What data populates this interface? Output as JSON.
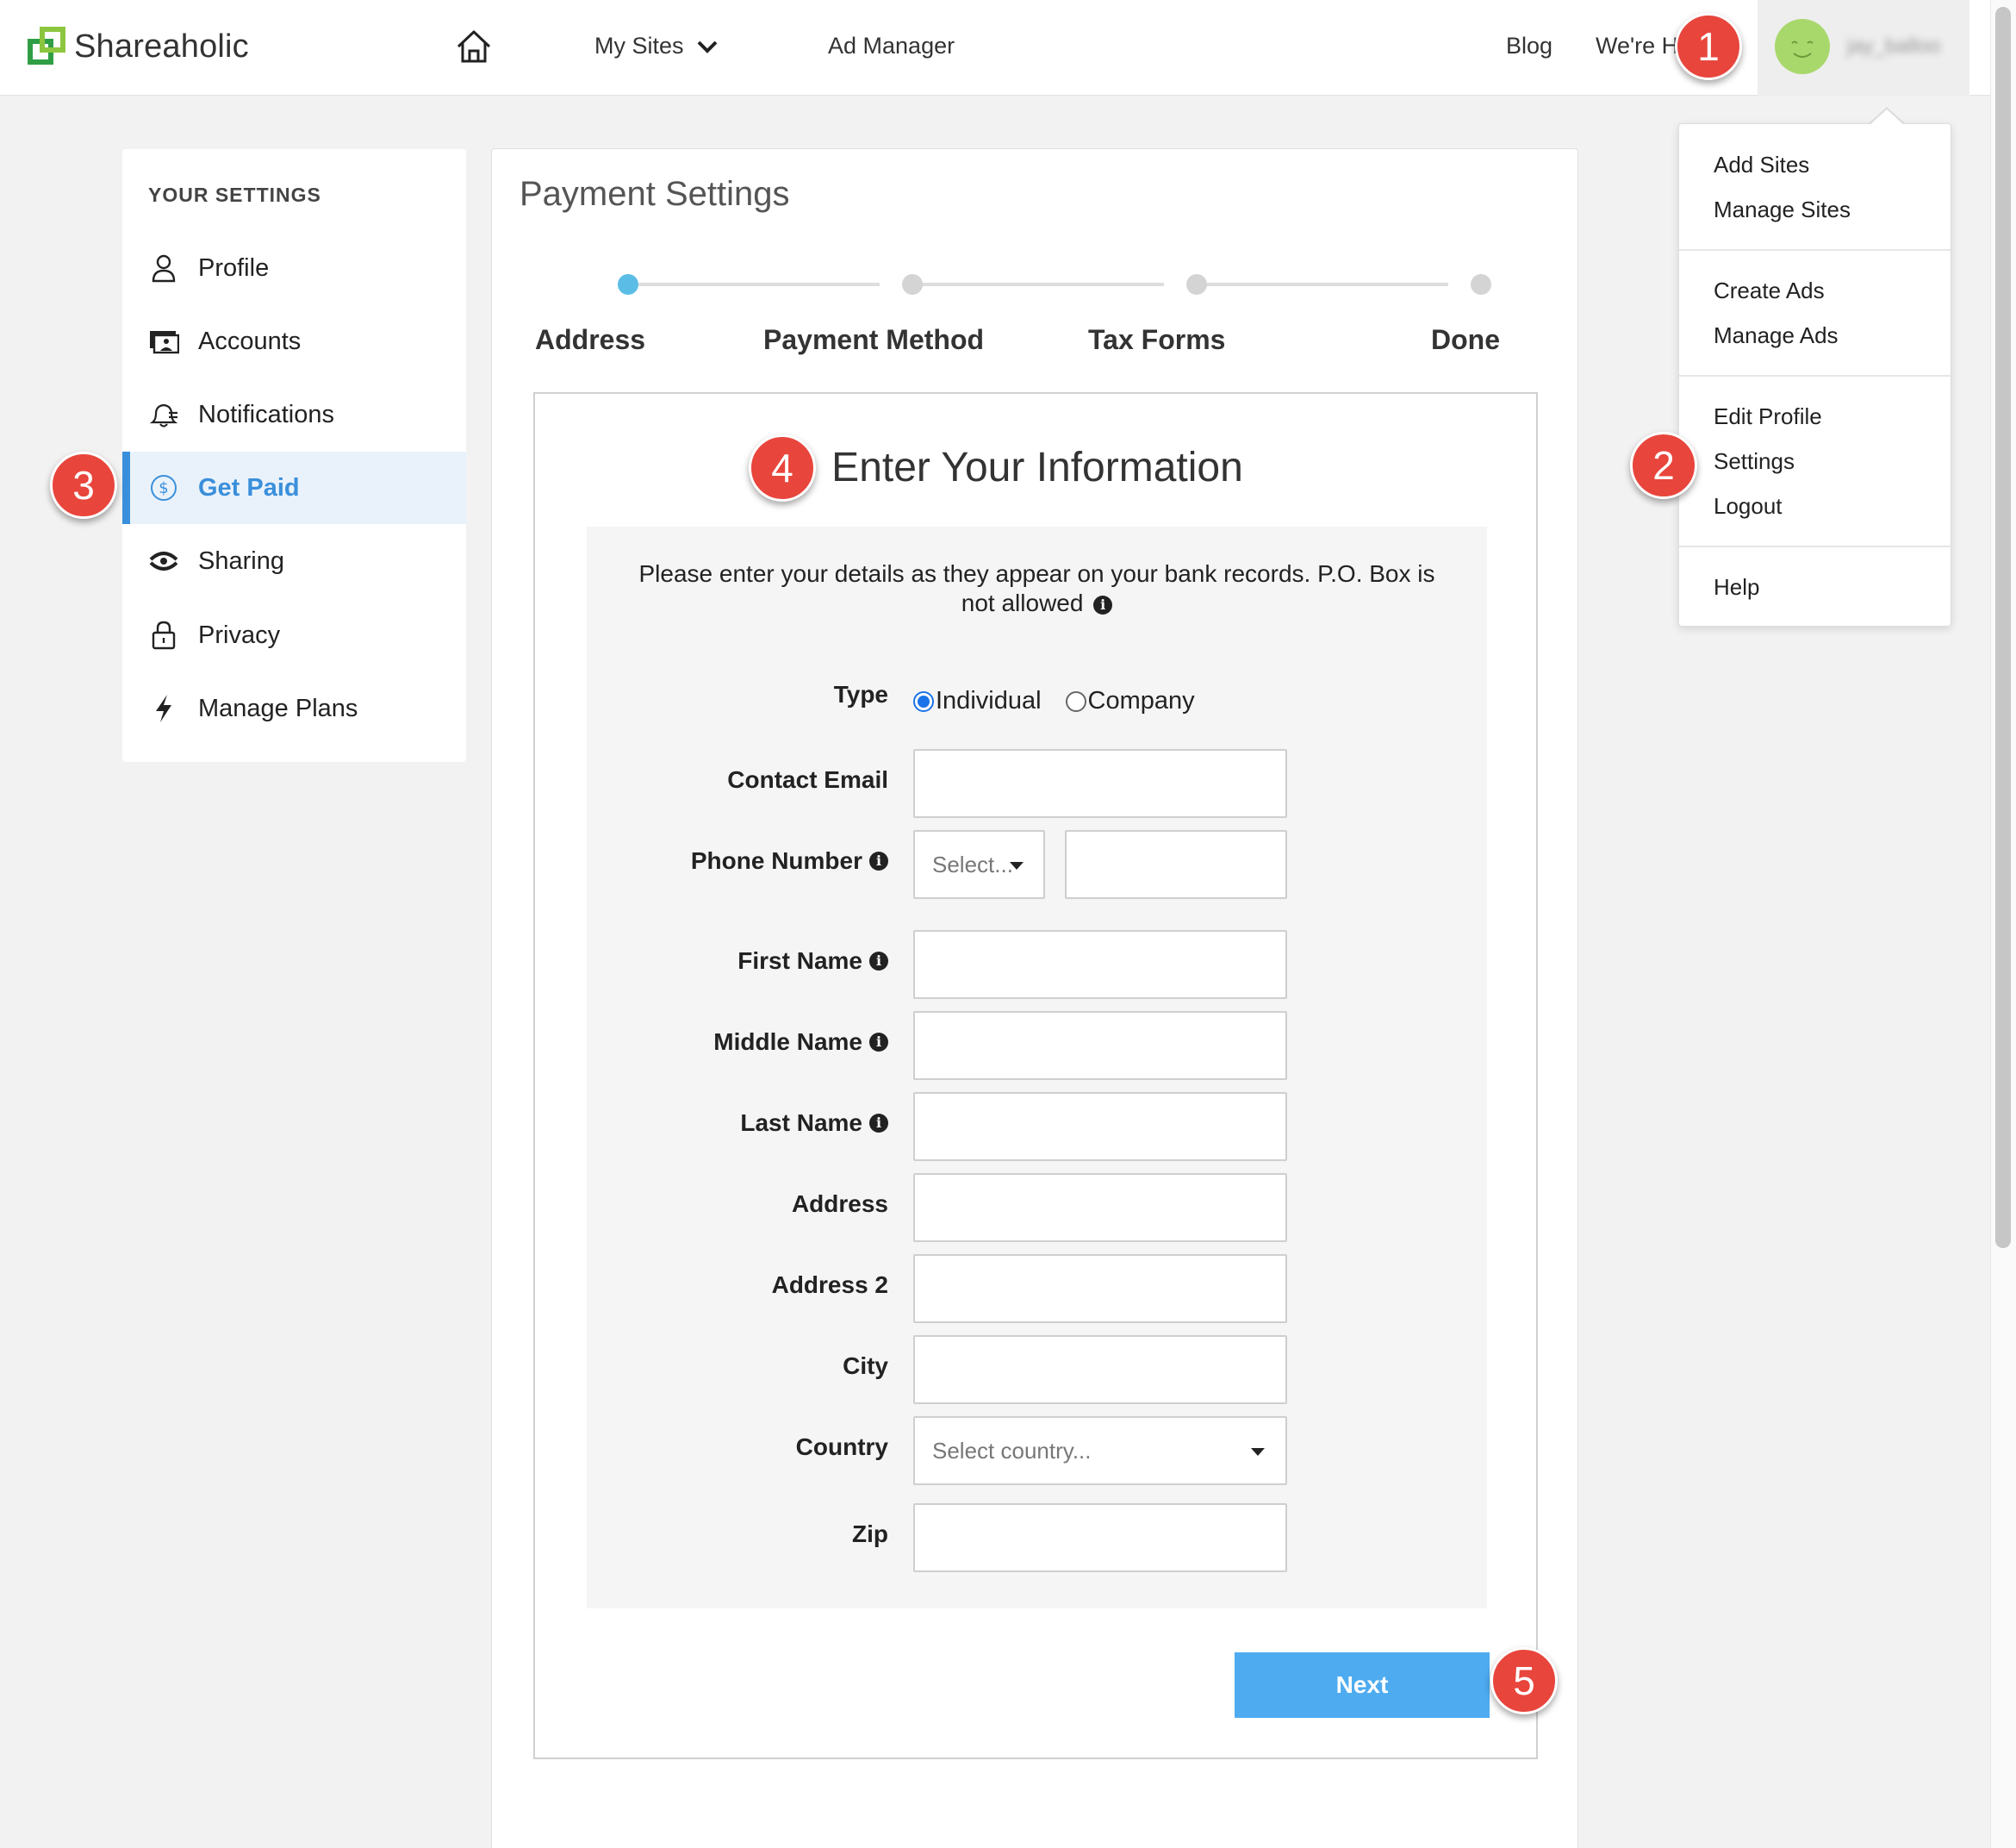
{
  "header": {
    "logo_text": "Shareaholic",
    "nav": {
      "my_sites": "My Sites",
      "ad_manager": "Ad Manager",
      "blog": "Blog",
      "help": "We're Here to Help"
    },
    "user": {
      "name": "jay_balloo"
    }
  },
  "dropdown": {
    "groups": [
      [
        "Add Sites",
        "Manage Sites"
      ],
      [
        "Create Ads",
        "Manage Ads"
      ],
      [
        "Edit Profile",
        "Settings",
        "Logout"
      ],
      [
        "Help"
      ]
    ],
    "add_sites": "Add Sites",
    "manage_sites": "Manage Sites",
    "create_ads": "Create Ads",
    "manage_ads": "Manage Ads",
    "edit_profile": "Edit Profile",
    "settings": "Settings",
    "logout": "Logout",
    "help": "Help"
  },
  "sidebar": {
    "title": "YOUR SETTINGS",
    "items": [
      {
        "label": "Profile",
        "icon": "user-icon"
      },
      {
        "label": "Accounts",
        "icon": "accounts-icon"
      },
      {
        "label": "Notifications",
        "icon": "bell-icon"
      },
      {
        "label": "Get Paid",
        "icon": "dollar-icon",
        "active": true
      },
      {
        "label": "Sharing",
        "icon": "sharing-icon"
      },
      {
        "label": "Privacy",
        "icon": "lock-icon"
      },
      {
        "label": "Manage Plans",
        "icon": "bolt-icon"
      }
    ]
  },
  "main": {
    "title": "Payment Settings",
    "steps": [
      "Address",
      "Payment Method",
      "Tax Forms",
      "Done"
    ],
    "active_step": 0,
    "form": {
      "title": "Enter Your Information",
      "notice": "Please enter your details as they appear on your bank records. P.O. Box is not allowed",
      "type_label": "Type",
      "type_options": [
        "Individual",
        "Company"
      ],
      "type_selected": "Individual",
      "contact_email": "Contact Email",
      "phone_number": "Phone Number",
      "phone_country_placeholder": "Select...",
      "first_name": "First Name",
      "middle_name": "Middle Name",
      "last_name": "Last Name",
      "address": "Address",
      "address2": "Address 2",
      "city": "City",
      "country": "Country",
      "country_placeholder": "Select country...",
      "zip": "Zip",
      "next_label": "Next"
    }
  },
  "callouts": [
    "1",
    "2",
    "3",
    "4",
    "5"
  ],
  "colors": {
    "accent": "#3a8fdb",
    "step_active": "#5bbde6",
    "button": "#4eabf0",
    "badge": "#e8453c"
  }
}
